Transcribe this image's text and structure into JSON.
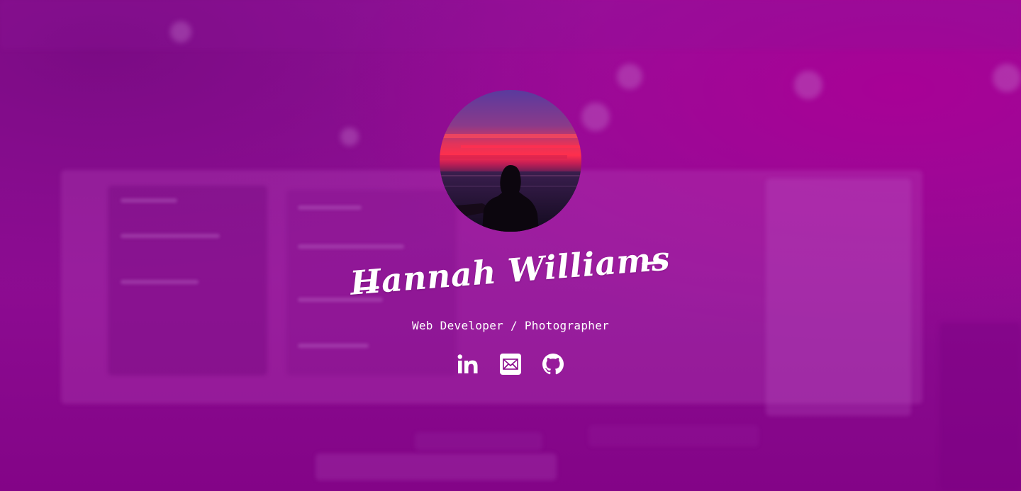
{
  "profile": {
    "name": "Hannah Williams",
    "subtitle": "Web Developer / Photographer",
    "avatar_icon": "sunset-silhouette-photo"
  },
  "social_links": [
    {
      "name": "linkedin",
      "icon": "linkedin-icon"
    },
    {
      "name": "email",
      "icon": "mail-icon"
    },
    {
      "name": "github",
      "icon": "github-icon"
    }
  ],
  "colors": {
    "overlay": "#8a0a8c",
    "text": "#ffffff"
  }
}
